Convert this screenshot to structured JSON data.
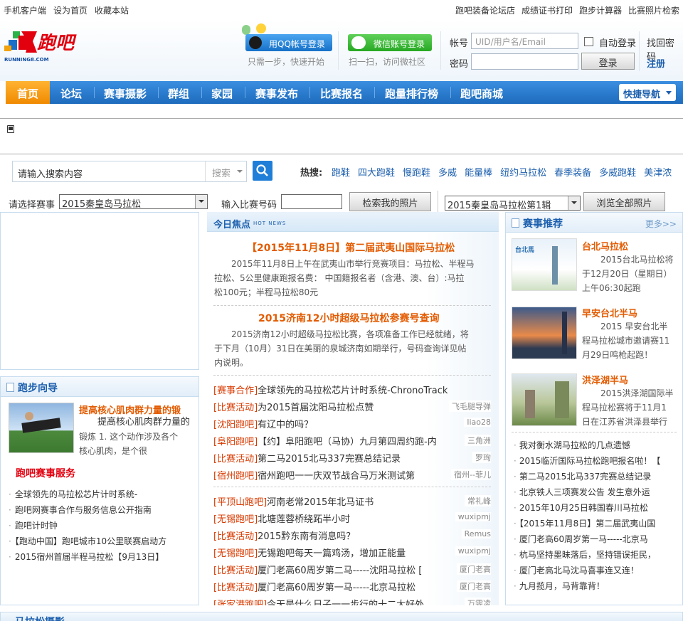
{
  "topbar": {
    "left": [
      "手机客户端",
      "设为首页",
      "收藏本站"
    ],
    "right": [
      "跑吧装备论坛店",
      "成绩证书打印",
      "跑步计算器",
      "比赛照片检索"
    ]
  },
  "logo": {
    "text": "跑吧",
    "sub": "RUNNING8.COM"
  },
  "login": {
    "qq_button": "用QQ帐号登录",
    "qq_hint": "只需一步，快速开始",
    "wechat_button": "微信账号登录",
    "wechat_hint": "扫一扫，访问微社区",
    "account_label": "帐号",
    "account_placeholder": "UID/用户名/Email",
    "password_label": "密码",
    "auto_login": "自动登录",
    "find_password": "找回密码",
    "login_button": "登录",
    "register": "注册"
  },
  "nav": {
    "items": [
      "首页",
      "论坛",
      "赛事摄影",
      "群组",
      "家园",
      "赛事发布",
      "比赛报名",
      "跑量排行榜",
      "跑吧商城"
    ],
    "quick_nav": "快捷导航"
  },
  "search": {
    "placeholder": "请输入搜索内容",
    "type": "搜索",
    "hot_label": "热搜:",
    "hot": [
      "跑鞋",
      "四大跑鞋",
      "慢跑鞋",
      "多威",
      "能量棒",
      "纽约马拉松",
      "春季装备",
      "多威跑鞋",
      "美津浓"
    ]
  },
  "photo_search": {
    "event_label": "请选择赛事",
    "event_value": "2015秦皇岛马拉松",
    "bib_label": "输入比赛号码",
    "search_button": "检索我的照片",
    "album_value": "2015秦皇岛马拉松第1辑",
    "browse_button": "浏览全部照片"
  },
  "focus": {
    "title": "今日焦点",
    "title_en": "HOT NEWS",
    "items": [
      {
        "headline": "【2015年11月8日】第二届武夷山国际马拉松",
        "lines": [
          "2015年11月8日上午在武夷山市举行竞赛项目：马拉松、半程马",
          "拉松、5公里健康跑报名费： 中国籍报名者（含港、澳、台）:马拉",
          "松100元；半程马拉松80元"
        ]
      },
      {
        "headline": "2015济南12小时超级马拉松参赛号查询",
        "lines": [
          "2015济南12小时超级马拉松比赛，各项准备工作已经就绪，将",
          "于下月（10月）31日在美丽的泉城济南如期举行，号码查询详见帖",
          "内说明。"
        ]
      }
    ],
    "list1": [
      {
        "tag": "[赛事合作]",
        "title": "全球领先的马拉松芯片计时系统-ChronoTrack",
        "author": ""
      },
      {
        "tag": "[比赛活动]",
        "title": "为2015首届沈阳马拉松点赞",
        "author": "飞毛腿导弹"
      },
      {
        "tag": "[沈阳跑吧]",
        "title": "有辽中的吗？",
        "author": "liao28"
      },
      {
        "tag": "[阜阳跑吧]",
        "title": "【约】阜阳跑吧（马协）九月第四周约跑-内",
        "author": "三角洲"
      },
      {
        "tag": "[比赛活动]",
        "title": "第二马2015北马337完赛总结记录",
        "author": "罗珣"
      },
      {
        "tag": "[宿州跑吧]",
        "title": "宿州跑吧一一庆双节战合马万米测试第",
        "author": "宿州--菲儿"
      }
    ],
    "list2": [
      {
        "tag": "[平顶山跑吧]",
        "title": "河南老常2015年北马证书",
        "author": "常礼峰"
      },
      {
        "tag": "[无锡跑吧]",
        "title": "北塘莲蓉桥绕跖半小时",
        "author": "wuxipmj"
      },
      {
        "tag": "[比赛活动]",
        "title": "2015黔东南有消息吗？",
        "author": "Remus"
      },
      {
        "tag": "[无锡跑吧]",
        "title": "无锡跑吧每天一篇鸡汤，增加正能量",
        "author": "wuxipmj"
      },
      {
        "tag": "[比赛活动]",
        "title": "厦门老高60周岁第二马-----沈阳马拉松 [",
        "author": "厦门老高"
      },
      {
        "tag": "[比赛活动]",
        "title": "厦门老高60周岁第一马-----北京马拉松",
        "author": "厦门老高"
      },
      {
        "tag": "[张家港跑吧]",
        "title": "今天是什么日子一一步行的十二大好处",
        "author": "万雯凌"
      }
    ]
  },
  "guide": {
    "title": "跑步向导",
    "feature_title": "提高核心肌肉群力量的锻",
    "feature_lines": [
      "提高核心肌肉群力量的",
      "锻炼  1. 这个动作涉及各个",
      "核心肌肉，是个很"
    ],
    "service_title": "跑吧赛事服务",
    "services": [
      "全球领先的马拉松芯片计时系统-",
      "跑吧网赛事合作与服务信息公开指南",
      "跑吧计时钟",
      "【跑动中国】跑吧城市10公里联赛启动方",
      "2015宿州首届半程马拉松【9月13日】"
    ]
  },
  "recommend": {
    "title": "赛事推荐",
    "more": "更多>>",
    "items": [
      {
        "title": "台北马拉松",
        "lines": [
          "2015台北马拉松将",
          "于12月20日（星期日）",
          "上午06:30起跑"
        ]
      },
      {
        "title": "早安台北半马",
        "lines": [
          "2015 早安台北半",
          "程马拉松城市邀请赛11",
          "月29日鸣枪起跑！"
        ]
      },
      {
        "title": "洪泽湖半马",
        "lines": [
          "2015洪泽湖国际半",
          "程马拉松赛将于11月1",
          "日在江苏省洪泽县举行"
        ]
      }
    ],
    "list": [
      "我对衡水湖马拉松的几点遗憾",
      "2015临沂国际马拉松跑吧报名啦！【",
      "第二马2015北马337完赛总结记录",
      "北京铁人三项赛发公告 发生意外运",
      "2015年10月25日韩国春川马拉松",
      "【2015年11月8日】第二届武夷山国",
      "厦门老高60周岁第一马-----北京马",
      "杭马坚持墨昧落后，坚持错误拒民，",
      "厦门老高北马沈马喜事连又连！",
      "九月揽月，马背靠背！"
    ]
  },
  "bottom": {
    "title": "马拉松摄影"
  },
  "colors": {
    "nav_blue": "#1d6bbd",
    "home_orange": "#f08a00",
    "headline_orange": "#e35b00",
    "tag_red": "#d83a00",
    "link_blue": "#1c5fae"
  }
}
